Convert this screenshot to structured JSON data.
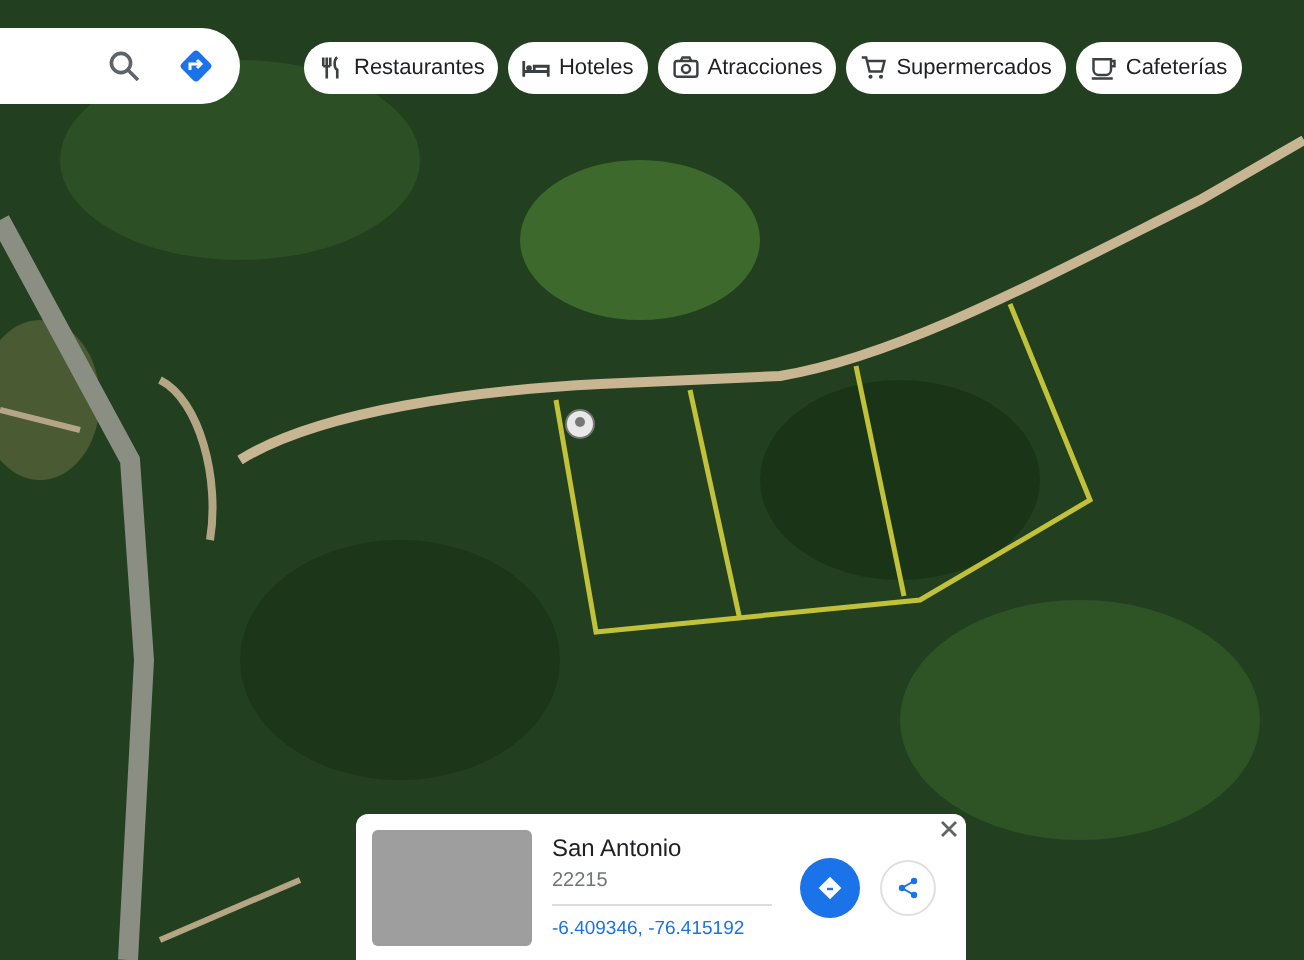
{
  "chips": [
    {
      "label": "Restaurantes",
      "kind": "restaurant"
    },
    {
      "label": "Hoteles",
      "kind": "hotel"
    },
    {
      "label": "Atracciones",
      "kind": "camera"
    },
    {
      "label": "Supermercados",
      "kind": "cart"
    },
    {
      "label": "Cafeterías",
      "kind": "coffee"
    }
  ],
  "place_card": {
    "title": "San Antonio",
    "subtitle": "22215",
    "coordinates": "-6.409346, -76.415192"
  }
}
